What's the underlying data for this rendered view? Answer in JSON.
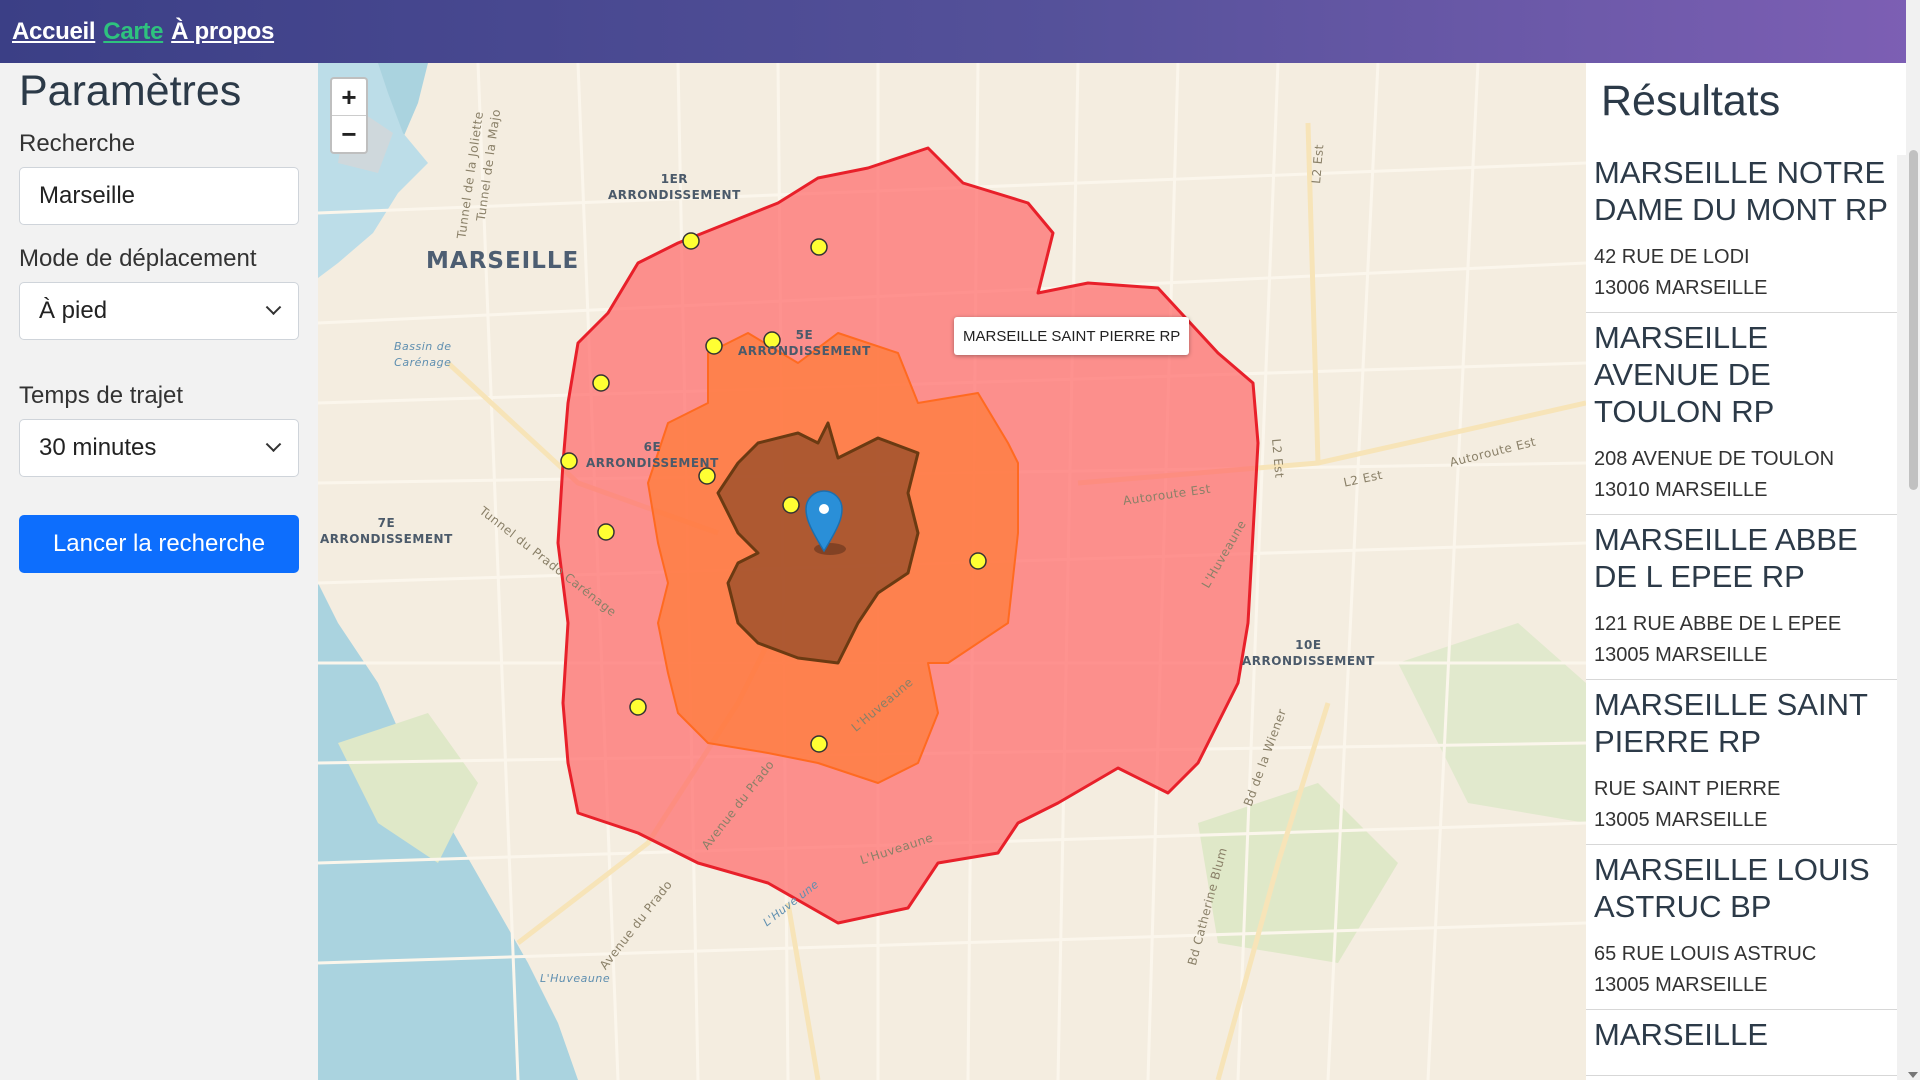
{
  "nav": {
    "items": [
      {
        "label": "Accueil",
        "active": false
      },
      {
        "label": "Carte",
        "active": true
      },
      {
        "label": "À propos",
        "active": false
      }
    ]
  },
  "params": {
    "title": "Paramètres",
    "search_label": "Recherche",
    "search_value": "Marseille",
    "mode_label": "Mode de déplacement",
    "mode_value": "À pied",
    "time_label": "Temps de trajet",
    "time_value": "30 minutes",
    "submit_label": "Lancer la recherche"
  },
  "map": {
    "zoom_in": "+",
    "zoom_out": "−",
    "tooltip": "MARSEILLE SAINT PIERRE RP",
    "labels": {
      "arr1": "1ER\nARRONDISSEMENT",
      "city": "MARSEILLE",
      "arr5": "5E\nARRONDISSEMENT",
      "arr6": "6E\nARRONDISSEMENT",
      "arr7": "7E\nARRONDISSEMENT",
      "arr10": "10E\nARRONDISSEMENT",
      "bassin": "Bassin de\nCarénage",
      "huveaune": "L'Huveaune"
    },
    "streets": {
      "joliette": "Tunnel de la Joliette",
      "majo": "Tunnel de la Majo",
      "prado_car": "Tunnel du Prado Carénage",
      "av_prado": "Avenue du Prado",
      "av_prado2": "Avenue du Prado",
      "l2est_top": "L2 Est",
      "l2est_mid": "L2 Est",
      "l2est_right": "L2 Est",
      "autoroute_est": "Autoroute Est",
      "autoroute_est2": "Autoroute Est",
      "catherine": "Bd Catherine Blum",
      "wiener": "Bd de la Wiener",
      "huveaune_r": "L'Huveaune",
      "huveaune_c": "L'Huveaune",
      "huveaune_s": "L'Huveaune",
      "huve_une": "L'Huve une"
    },
    "colors": {
      "zone_outer": "#ff6b6b",
      "zone_mid": "#ff7a33",
      "zone_inner": "#a0522d",
      "marker": "#2a8fd8",
      "point": "#ffff33"
    }
  },
  "results": {
    "title": "Résultats",
    "items": [
      {
        "name": "MARSEILLE NOTRE DAME DU MONT RP",
        "street": "42 RUE DE LODI",
        "city": "13006 MARSEILLE"
      },
      {
        "name": "MARSEILLE AVENUE DE TOULON RP",
        "street": "208 AVENUE DE TOULON",
        "city": "13010 MARSEILLE"
      },
      {
        "name": "MARSEILLE ABBE DE L EPEE RP",
        "street": "121 RUE ABBE DE L EPEE",
        "city": "13005 MARSEILLE"
      },
      {
        "name": "MARSEILLE SAINT PIERRE RP",
        "street": "RUE SAINT PIERRE",
        "city": "13005 MARSEILLE"
      },
      {
        "name": "MARSEILLE LOUIS ASTRUC BP",
        "street": "65 RUE LOUIS ASTRUC",
        "city": "13005 MARSEILLE"
      },
      {
        "name": "MARSEILLE",
        "street": "",
        "city": ""
      }
    ]
  }
}
